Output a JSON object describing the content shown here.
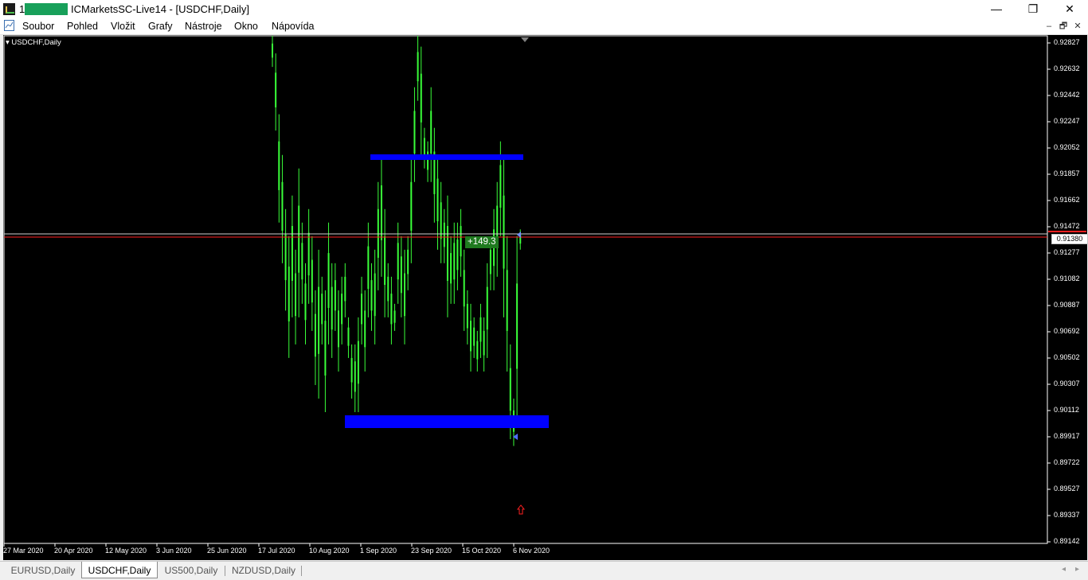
{
  "window": {
    "title_prefix": "1",
    "title": "ICMarketsSC-Live14 - [USDCHF,Daily]",
    "minimize_glyph": "—",
    "restore_glyph": "❐",
    "close_glyph": "✕"
  },
  "menu": {
    "items": [
      "Soubor",
      "Pohled",
      "Vložit",
      "Grafy",
      "Nástroje",
      "Okno",
      "Nápovída"
    ]
  },
  "mdi": {
    "minimize_glyph": "–",
    "restore_glyph": "🗗",
    "close_glyph": "✕"
  },
  "chart": {
    "symbol_label": "USDCHF,Daily",
    "profit_label": "+149.3",
    "current_price": "0.91380",
    "price_axis": [
      "0.92827",
      "0.92632",
      "0.92442",
      "0.92247",
      "0.92052",
      "0.91857",
      "0.91662",
      "0.91472",
      "0.91277",
      "0.91082",
      "0.90887",
      "0.90692",
      "0.90502",
      "0.90307",
      "0.90112",
      "0.89917",
      "0.89722",
      "0.89527",
      "0.89337",
      "0.89142"
    ],
    "date_axis": [
      "27 Mar 2020",
      "20 Apr 2020",
      "12 May 2020",
      "3 Jun 2020",
      "25 Jun 2020",
      "17 Jul 2020",
      "10 Aug 2020",
      "1 Sep 2020",
      "23 Sep 2020",
      "15 Oct 2020",
      "6 Nov 2020"
    ],
    "colors": {
      "background": "#000000",
      "candle": "#39ff39",
      "zone": "#0000ff",
      "bid_line": "#ff2020",
      "ask_line": "#d0d0d0",
      "profit_tag": "#1f7a1f",
      "arrow": "#ff2020"
    },
    "candle_series": [
      [
        0.929,
        0.9265
      ],
      [
        0.9275,
        0.9218
      ],
      [
        0.923,
        0.915
      ],
      [
        0.92,
        0.912
      ],
      [
        0.916,
        0.9085
      ],
      [
        0.914,
        0.905
      ],
      [
        0.917,
        0.908
      ],
      [
        0.913,
        0.906
      ],
      [
        0.919,
        0.908
      ],
      [
        0.915,
        0.909
      ],
      [
        0.912,
        0.906
      ],
      [
        0.916,
        0.909
      ],
      [
        0.914,
        0.907
      ],
      [
        0.91,
        0.903
      ],
      [
        0.913,
        0.902
      ],
      [
        0.911,
        0.906
      ],
      [
        0.91,
        0.901
      ],
      [
        0.915,
        0.906
      ],
      [
        0.912,
        0.905
      ],
      [
        0.912,
        0.907
      ],
      [
        0.91,
        0.904
      ],
      [
        0.911,
        0.906
      ],
      [
        0.912,
        0.908
      ],
      [
        0.908,
        0.905
      ],
      [
        0.906,
        0.902
      ],
      [
        0.906,
        0.901
      ],
      [
        0.908,
        0.901
      ],
      [
        0.911,
        0.906
      ],
      [
        0.91,
        0.904
      ],
      [
        0.915,
        0.908
      ],
      [
        0.912,
        0.907
      ],
      [
        0.913,
        0.906
      ],
      [
        0.918,
        0.91
      ],
      [
        0.92,
        0.911
      ],
      [
        0.916,
        0.908
      ],
      [
        0.912,
        0.908
      ],
      [
        0.911,
        0.906
      ],
      [
        0.909,
        0.907
      ],
      [
        0.915,
        0.909
      ],
      [
        0.914,
        0.908
      ],
      [
        0.913,
        0.906
      ],
      [
        0.914,
        0.91
      ],
      [
        0.92,
        0.912
      ],
      [
        0.925,
        0.918
      ],
      [
        0.93,
        0.924
      ],
      [
        0.928,
        0.92
      ],
      [
        0.922,
        0.919
      ],
      [
        0.921,
        0.918
      ],
      [
        0.925,
        0.918
      ],
      [
        0.922,
        0.915
      ],
      [
        0.92,
        0.913
      ],
      [
        0.918,
        0.912
      ],
      [
        0.916,
        0.912
      ],
      [
        0.917,
        0.908
      ],
      [
        0.914,
        0.909
      ],
      [
        0.915,
        0.909
      ],
      [
        0.915,
        0.91
      ],
      [
        0.916,
        0.911
      ],
      [
        0.913,
        0.907
      ],
      [
        0.91,
        0.906
      ],
      [
        0.909,
        0.904
      ],
      [
        0.908,
        0.905
      ],
      [
        0.907,
        0.904
      ],
      [
        0.909,
        0.905
      ],
      [
        0.908,
        0.904
      ],
      [
        0.912,
        0.905
      ],
      [
        0.914,
        0.91
      ],
      [
        0.916,
        0.91
      ],
      [
        0.918,
        0.911
      ],
      [
        0.921,
        0.914
      ],
      [
        0.92,
        0.908
      ],
      [
        0.914,
        0.904
      ],
      [
        0.906,
        0.899
      ],
      [
        0.902,
        0.8985
      ],
      [
        0.914,
        0.9
      ],
      [
        0.9145,
        0.913
      ]
    ]
  },
  "tabs": [
    "EURUSD,Daily",
    "USDCHF,Daily",
    "US500,Daily",
    "NZDUSD,Daily"
  ],
  "tab_arrows": [
    "◂",
    "▸"
  ]
}
